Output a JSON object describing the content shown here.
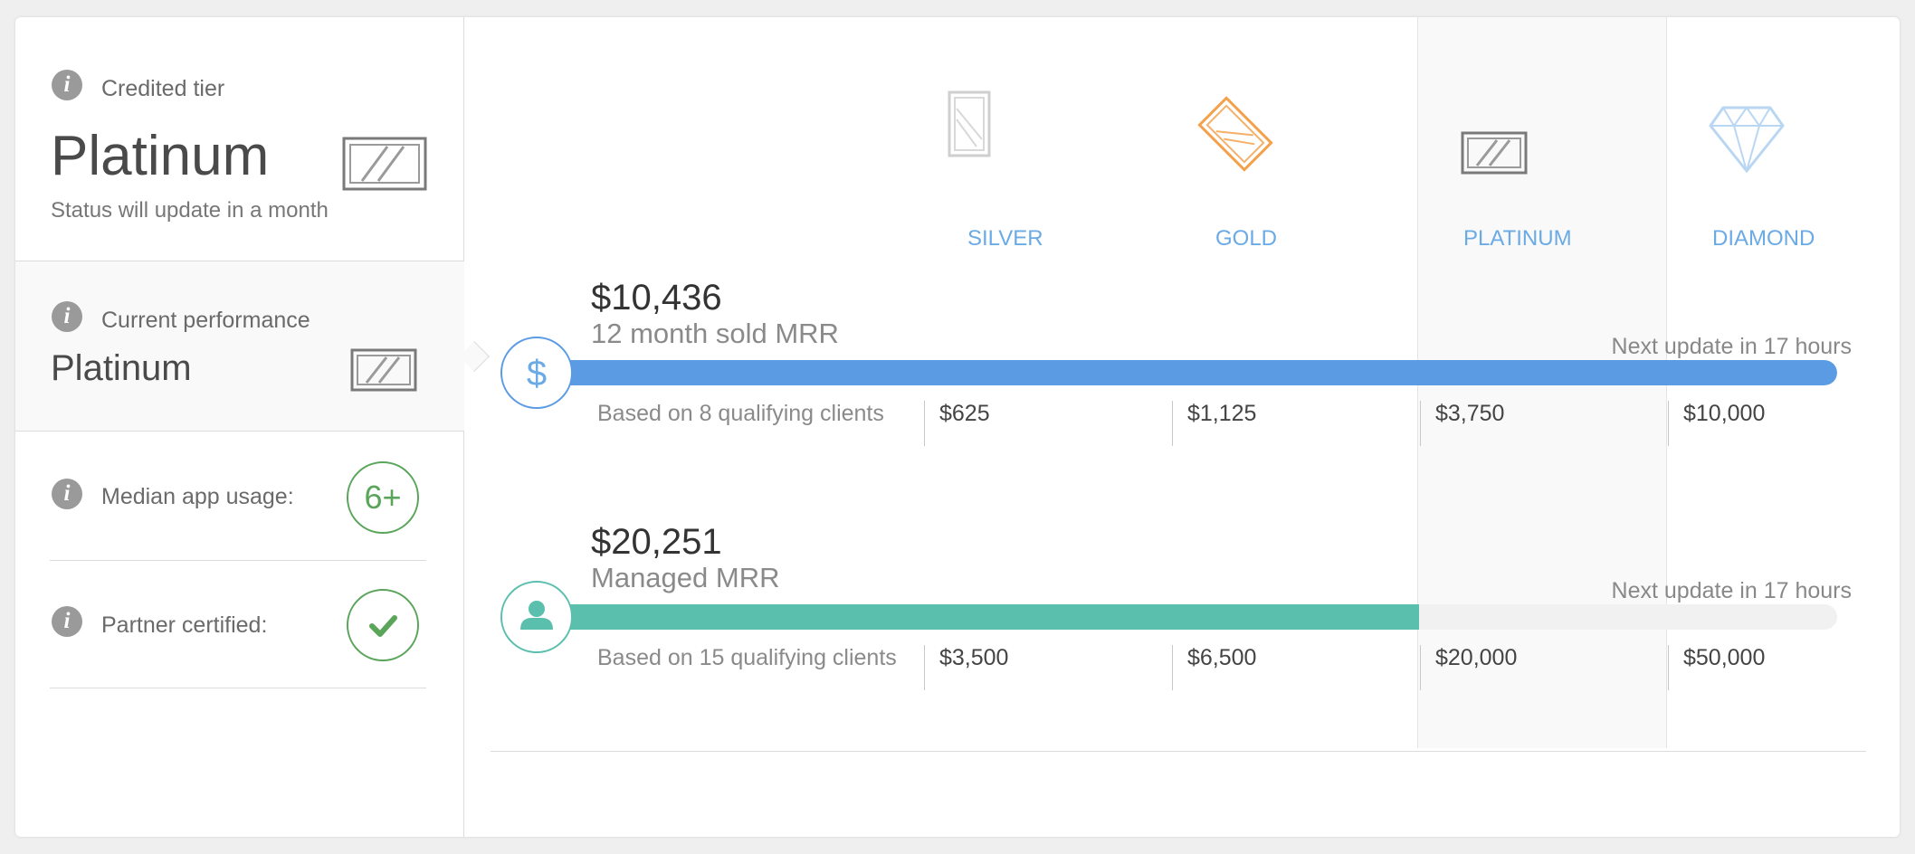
{
  "credited": {
    "label": "Credited tier",
    "tier": "Platinum",
    "status": "Status will update in a month",
    "icon": "platinum-card-icon"
  },
  "current": {
    "label": "Current performance",
    "tier": "Platinum",
    "icon": "platinum-card-icon"
  },
  "app_usage": {
    "label": "Median app usage:",
    "value": "6+"
  },
  "certified": {
    "label": "Partner certified:",
    "icon": "checkmark-icon"
  },
  "tiers": [
    {
      "name": "SILVER",
      "icon": "silver-card-icon",
      "color": "#cfcfcf"
    },
    {
      "name": "GOLD",
      "icon": "gold-card-icon",
      "color": "#f5a04a"
    },
    {
      "name": "PLATINUM",
      "icon": "platinum-card-icon",
      "color": "#8a8a8a"
    },
    {
      "name": "DIAMOND",
      "icon": "diamond-icon",
      "color": "#b9d6f2"
    }
  ],
  "metrics": [
    {
      "amount": "$10,436",
      "label": "12 month sold MRR",
      "next_update": "Next update in 17 hours",
      "clients": "Based on 8 qualifying clients",
      "thresholds": [
        "$625",
        "$1,125",
        "$3,750",
        "$10,000"
      ],
      "progress": 1.0,
      "color": "#5b9be3",
      "icon": "dollar-icon"
    },
    {
      "amount": "$20,251",
      "label": "Managed MRR",
      "next_update": "Next update in 17 hours",
      "clients": "Based on 15 qualifying clients",
      "thresholds": [
        "$3,500",
        "$6,500",
        "$20,000",
        "$50,000"
      ],
      "progress": 0.677,
      "color": "#5bbfae",
      "icon": "person-icon"
    }
  ]
}
